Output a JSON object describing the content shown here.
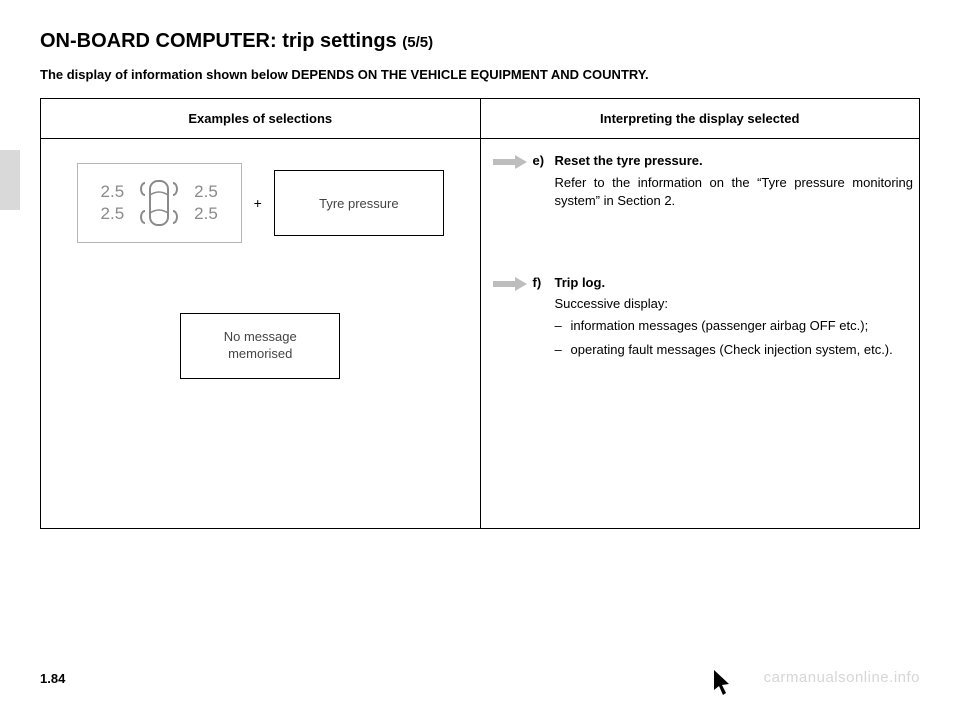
{
  "title": {
    "main": "ON-BOARD COMPUTER: trip settings",
    "sub": "(5/5)"
  },
  "note": "The display of information shown below DEPENDS ON THE VEHICLE EQUIPMENT AND COUNTRY.",
  "table": {
    "headers": {
      "left": "Examples of selections",
      "right": "Interpreting the display selected"
    },
    "left": {
      "tyre_values": {
        "fl": "2.5",
        "fr": "2.5",
        "rl": "2.5",
        "rr": "2.5"
      },
      "plus": "+",
      "tyre_label": "Tyre pressure",
      "no_msg_line1": "No message",
      "no_msg_line2": "memorised"
    },
    "right": {
      "e": {
        "key": "e)",
        "title": "Reset the tyre pressure.",
        "para": "Refer to the information on the “Tyre pressure monitoring system” in Section 2."
      },
      "f": {
        "key": "f)",
        "title": "Trip log.",
        "sub": "Successive display:",
        "bullets": [
          "information messages (passenger airbag OFF etc.);",
          "operating fault messages (Check injection system, etc.)."
        ]
      }
    }
  },
  "page_num": "1.84",
  "watermark": "carmanualsonline.info"
}
